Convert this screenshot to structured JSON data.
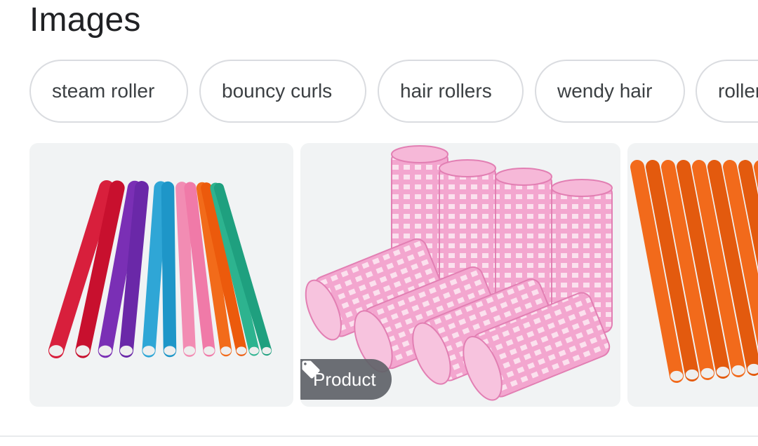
{
  "section": {
    "title": "Images"
  },
  "chips": [
    {
      "label": "steam roller"
    },
    {
      "label": "bouncy curls"
    },
    {
      "label": "hair rollers"
    },
    {
      "label": "wendy hair"
    },
    {
      "label": "rollers"
    }
  ],
  "images": [
    {
      "subject": "flexible foam hair rollers, multicolor",
      "colors": [
        "#d81f3c",
        "#c8102e",
        "#7a2fb5",
        "#6a28a8",
        "#2fa6d6",
        "#1e96c8",
        "#f28cb3",
        "#f07aa8",
        "#f26b1a",
        "#ec5a0c",
        "#2db38f",
        "#1fa07f"
      ]
    },
    {
      "subject": "pink mesh hair rollers",
      "colors": [
        "#f3a6cf",
        "#e98bbd"
      ],
      "badge": {
        "label": "Product",
        "icon": "tag-icon"
      }
    },
    {
      "subject": "orange flexible hair rollers",
      "colors": [
        "#f26a1b",
        "#e35a0e"
      ]
    }
  ]
}
